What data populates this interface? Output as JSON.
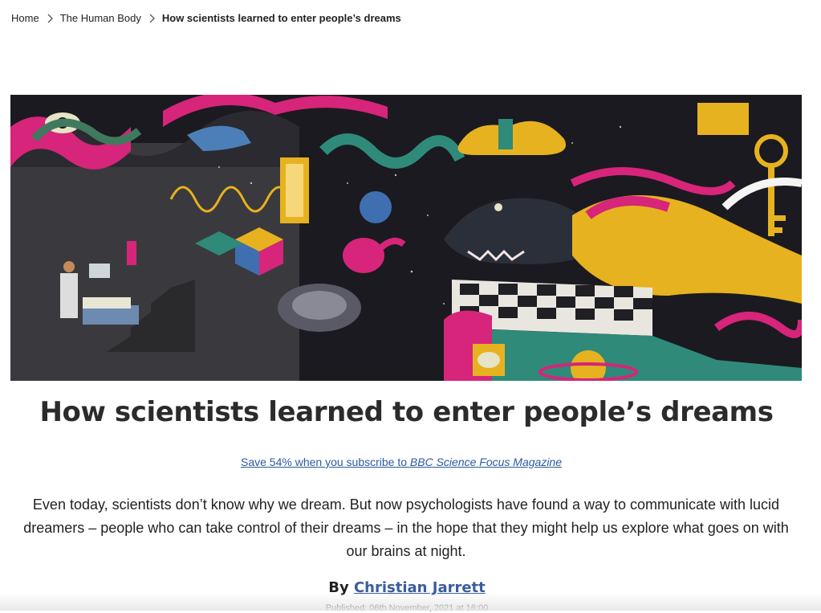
{
  "breadcrumb": {
    "home": "Home",
    "section": "The Human Body",
    "current": "How scientists learned to enter people’s dreams"
  },
  "hero": {
    "description_icon": "dream-illustration"
  },
  "article": {
    "title": "How scientists learned to enter people’s dreams",
    "promo_prefix": "Save 54% when you subscribe to ",
    "promo_magazine": "BBC Science Focus Magazine",
    "standfirst": "Even today, scientists don’t know why we dream. But now psychologists have found a way to communicate with lucid dreamers – people who can take control of their dreams – in the hope that they might help us explore what goes on with our brains at night.",
    "byline_prefix": "By ",
    "author": "Christian Jarrett",
    "published": "Published: 06th November, 2021 at 16:00"
  },
  "colors": {
    "link": "#2c5aa0",
    "author_link": "#3a5d9c",
    "magenta": "#d6257a",
    "gold": "#e7b21f",
    "teal": "#2f8a7a",
    "blue": "#3f6fb0"
  }
}
